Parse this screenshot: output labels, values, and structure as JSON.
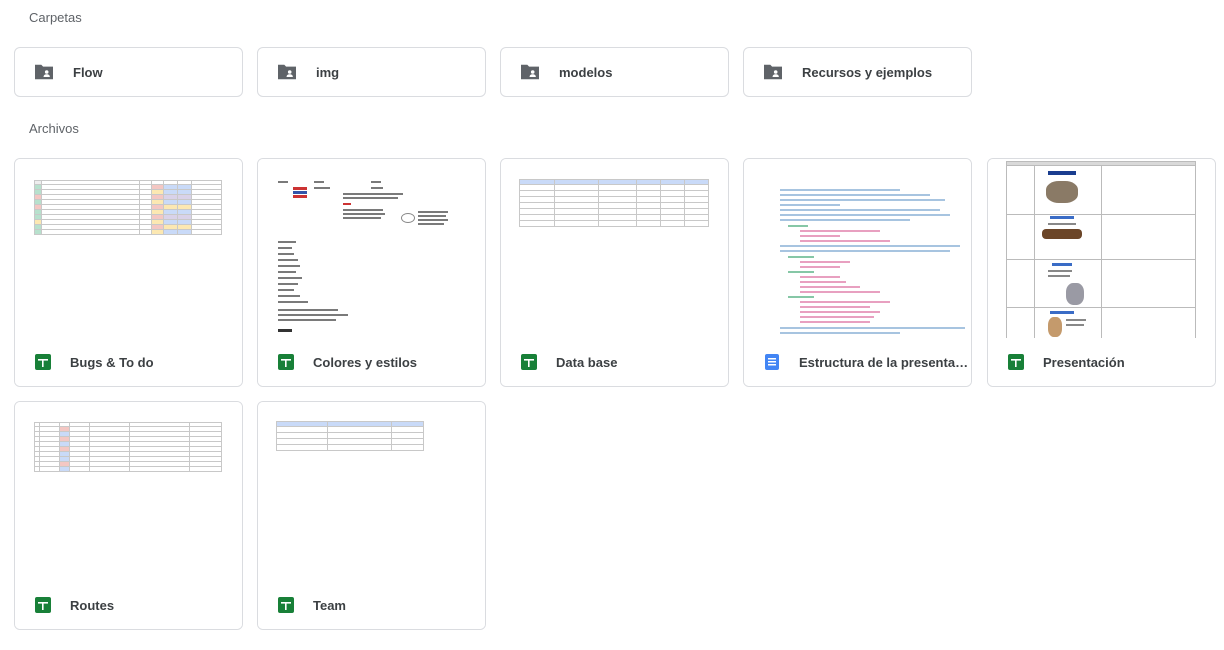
{
  "folders_section": {
    "title": "Carpetas"
  },
  "files_section": {
    "title": "Archivos"
  },
  "folders": [
    {
      "name": "Flow",
      "icon": "shared-folder-icon"
    },
    {
      "name": "img",
      "icon": "shared-folder-icon"
    },
    {
      "name": "modelos",
      "icon": "shared-folder-icon"
    },
    {
      "name": "Recursos y ejemplos",
      "icon": "shared-folder-icon"
    }
  ],
  "files": [
    {
      "name": "Bugs & To do",
      "type": "sheets",
      "icon": "google-sheets-icon"
    },
    {
      "name": "Colores y estilos",
      "type": "sheets",
      "icon": "google-sheets-icon"
    },
    {
      "name": "Data base",
      "type": "sheets",
      "icon": "google-sheets-icon"
    },
    {
      "name": "Estructura de la presentación",
      "type": "docs",
      "icon": "google-docs-icon"
    },
    {
      "name": "Presentación",
      "type": "sheets",
      "icon": "google-sheets-icon"
    },
    {
      "name": "Routes",
      "type": "sheets",
      "icon": "google-sheets-icon"
    },
    {
      "name": "Team",
      "type": "sheets",
      "icon": "google-sheets-icon"
    }
  ],
  "colors": {
    "sheets_green": "#188038",
    "docs_blue": "#4285f4",
    "folder_grey": "#5f6368",
    "border": "#dadce0"
  }
}
